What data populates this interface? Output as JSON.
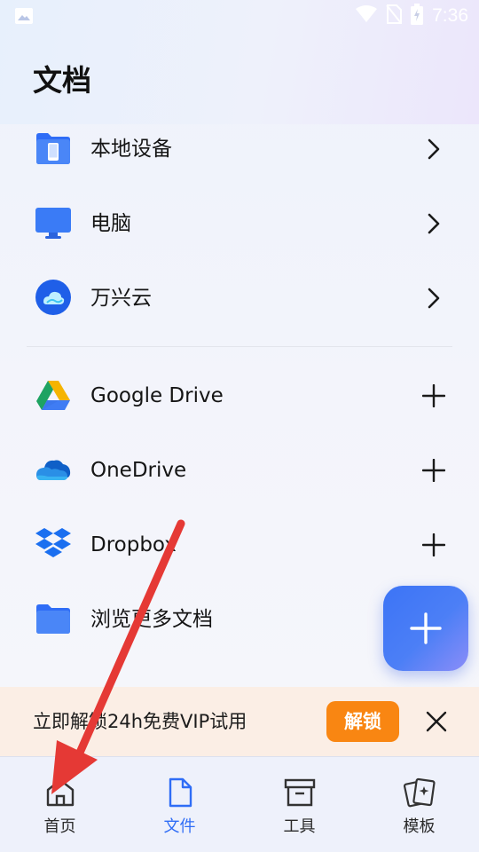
{
  "status_bar": {
    "time": "7:36",
    "icons": [
      "image-icon",
      "wifi-icon",
      "no-sim-icon",
      "battery-charging-icon"
    ]
  },
  "page": {
    "title": "文档"
  },
  "local_items": [
    {
      "label": "本地设备",
      "icon": "device-folder-icon",
      "action": "chevron-right-icon"
    },
    {
      "label": "电脑",
      "icon": "monitor-icon",
      "action": "chevron-right-icon"
    },
    {
      "label": "万兴云",
      "icon": "wondershare-cloud-icon",
      "action": "chevron-right-icon"
    }
  ],
  "cloud_items": [
    {
      "label": "Google Drive",
      "icon": "google-drive-icon",
      "action": "plus-icon"
    },
    {
      "label": "OneDrive",
      "icon": "onedrive-icon",
      "action": "plus-icon"
    },
    {
      "label": "Dropbox",
      "icon": "dropbox-icon",
      "action": "plus-icon"
    },
    {
      "label": "浏览更多文档",
      "icon": "folder-icon"
    }
  ],
  "fab": {
    "icon": "plus-icon"
  },
  "promo": {
    "text": "立即解锁24h免费VIP试用",
    "button": "解锁",
    "bg_color": "#fbeee5",
    "button_color": "#f98612"
  },
  "tabs": [
    {
      "label": "首页",
      "icon": "home-icon",
      "active": false
    },
    {
      "label": "文件",
      "icon": "file-icon",
      "active": true
    },
    {
      "label": "工具",
      "icon": "toolbox-icon",
      "active": false
    },
    {
      "label": "模板",
      "icon": "template-cards-icon",
      "active": false
    }
  ],
  "colors": {
    "accent": "#2f6df6",
    "annotation_arrow": "#e53935"
  }
}
